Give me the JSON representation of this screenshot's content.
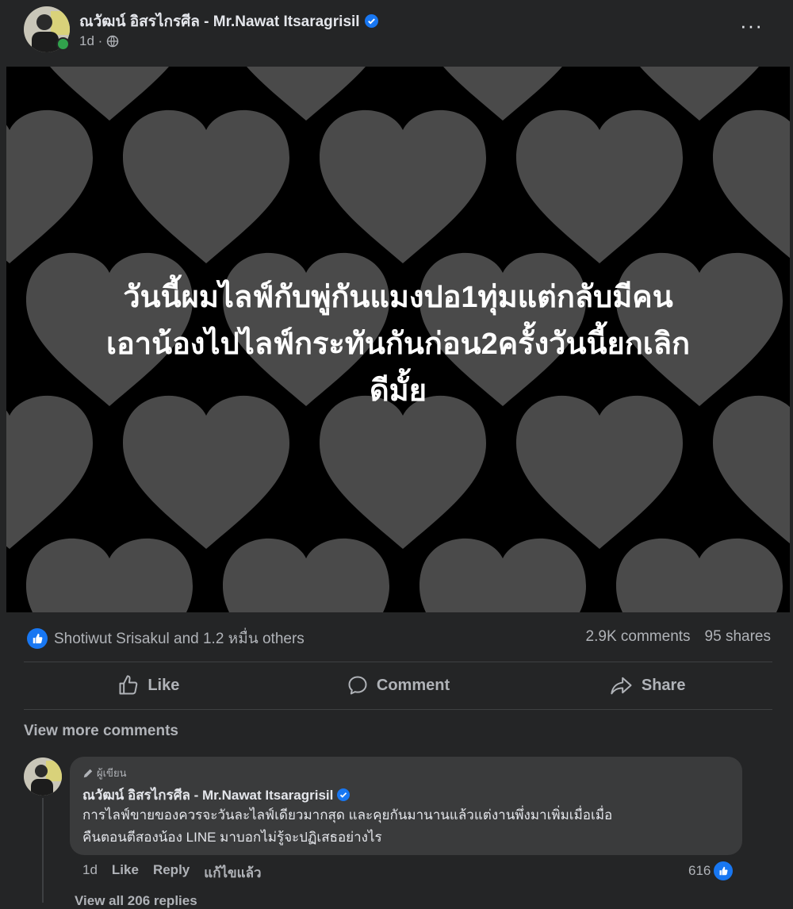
{
  "post": {
    "author": "ณวัฒน์ อิสรไกรศีล - Mr.Nawat Itsaragrisil",
    "time": "1d ·",
    "more_label": "···",
    "image_text": [
      "วันนี้ผมไลฟ์กับพู่กันแมงปอ1ทุ่มแต่กลับมีคน",
      "เอาน้องไปไลฟ์กระทันกันก่อน2ครั้งวันนี้ยกเลิก",
      "ดีมั้ย"
    ]
  },
  "stats": {
    "reactions_text": "Shotiwut Srisakul and 1.2 หมื่น others",
    "comments": "2.9K comments",
    "shares": "95 shares"
  },
  "actions": {
    "like": "Like",
    "comment": "Comment",
    "share": "Share"
  },
  "comments": {
    "view_more": "View more comments",
    "item": {
      "badge": "ผู้เขียน",
      "author": "ณวัฒน์ อิสรไกรศีล - Mr.Nawat Itsaragrisil",
      "text_line1": "การไลฟ์ขายของควรจะวันละไลฟ์เดียวมากสุด และคุยกันมานานแล้วแต่งานพึ่งมาเพิ่มเมื่อเมื่อ",
      "text_line2": "คืนตอนตีสองน้อง LINE มาบอกไม่รู้จะปฏิเสธอย่างไร",
      "time": "1d",
      "like": "Like",
      "reply": "Reply",
      "edited": "แก้ไขแล้ว",
      "reaction_count": "616"
    },
    "view_replies": "View all 206 replies"
  },
  "colors": {
    "background": "#242526",
    "image_bg": "#000000",
    "heart": "#4a4a4a",
    "accent": "#1877f2"
  }
}
